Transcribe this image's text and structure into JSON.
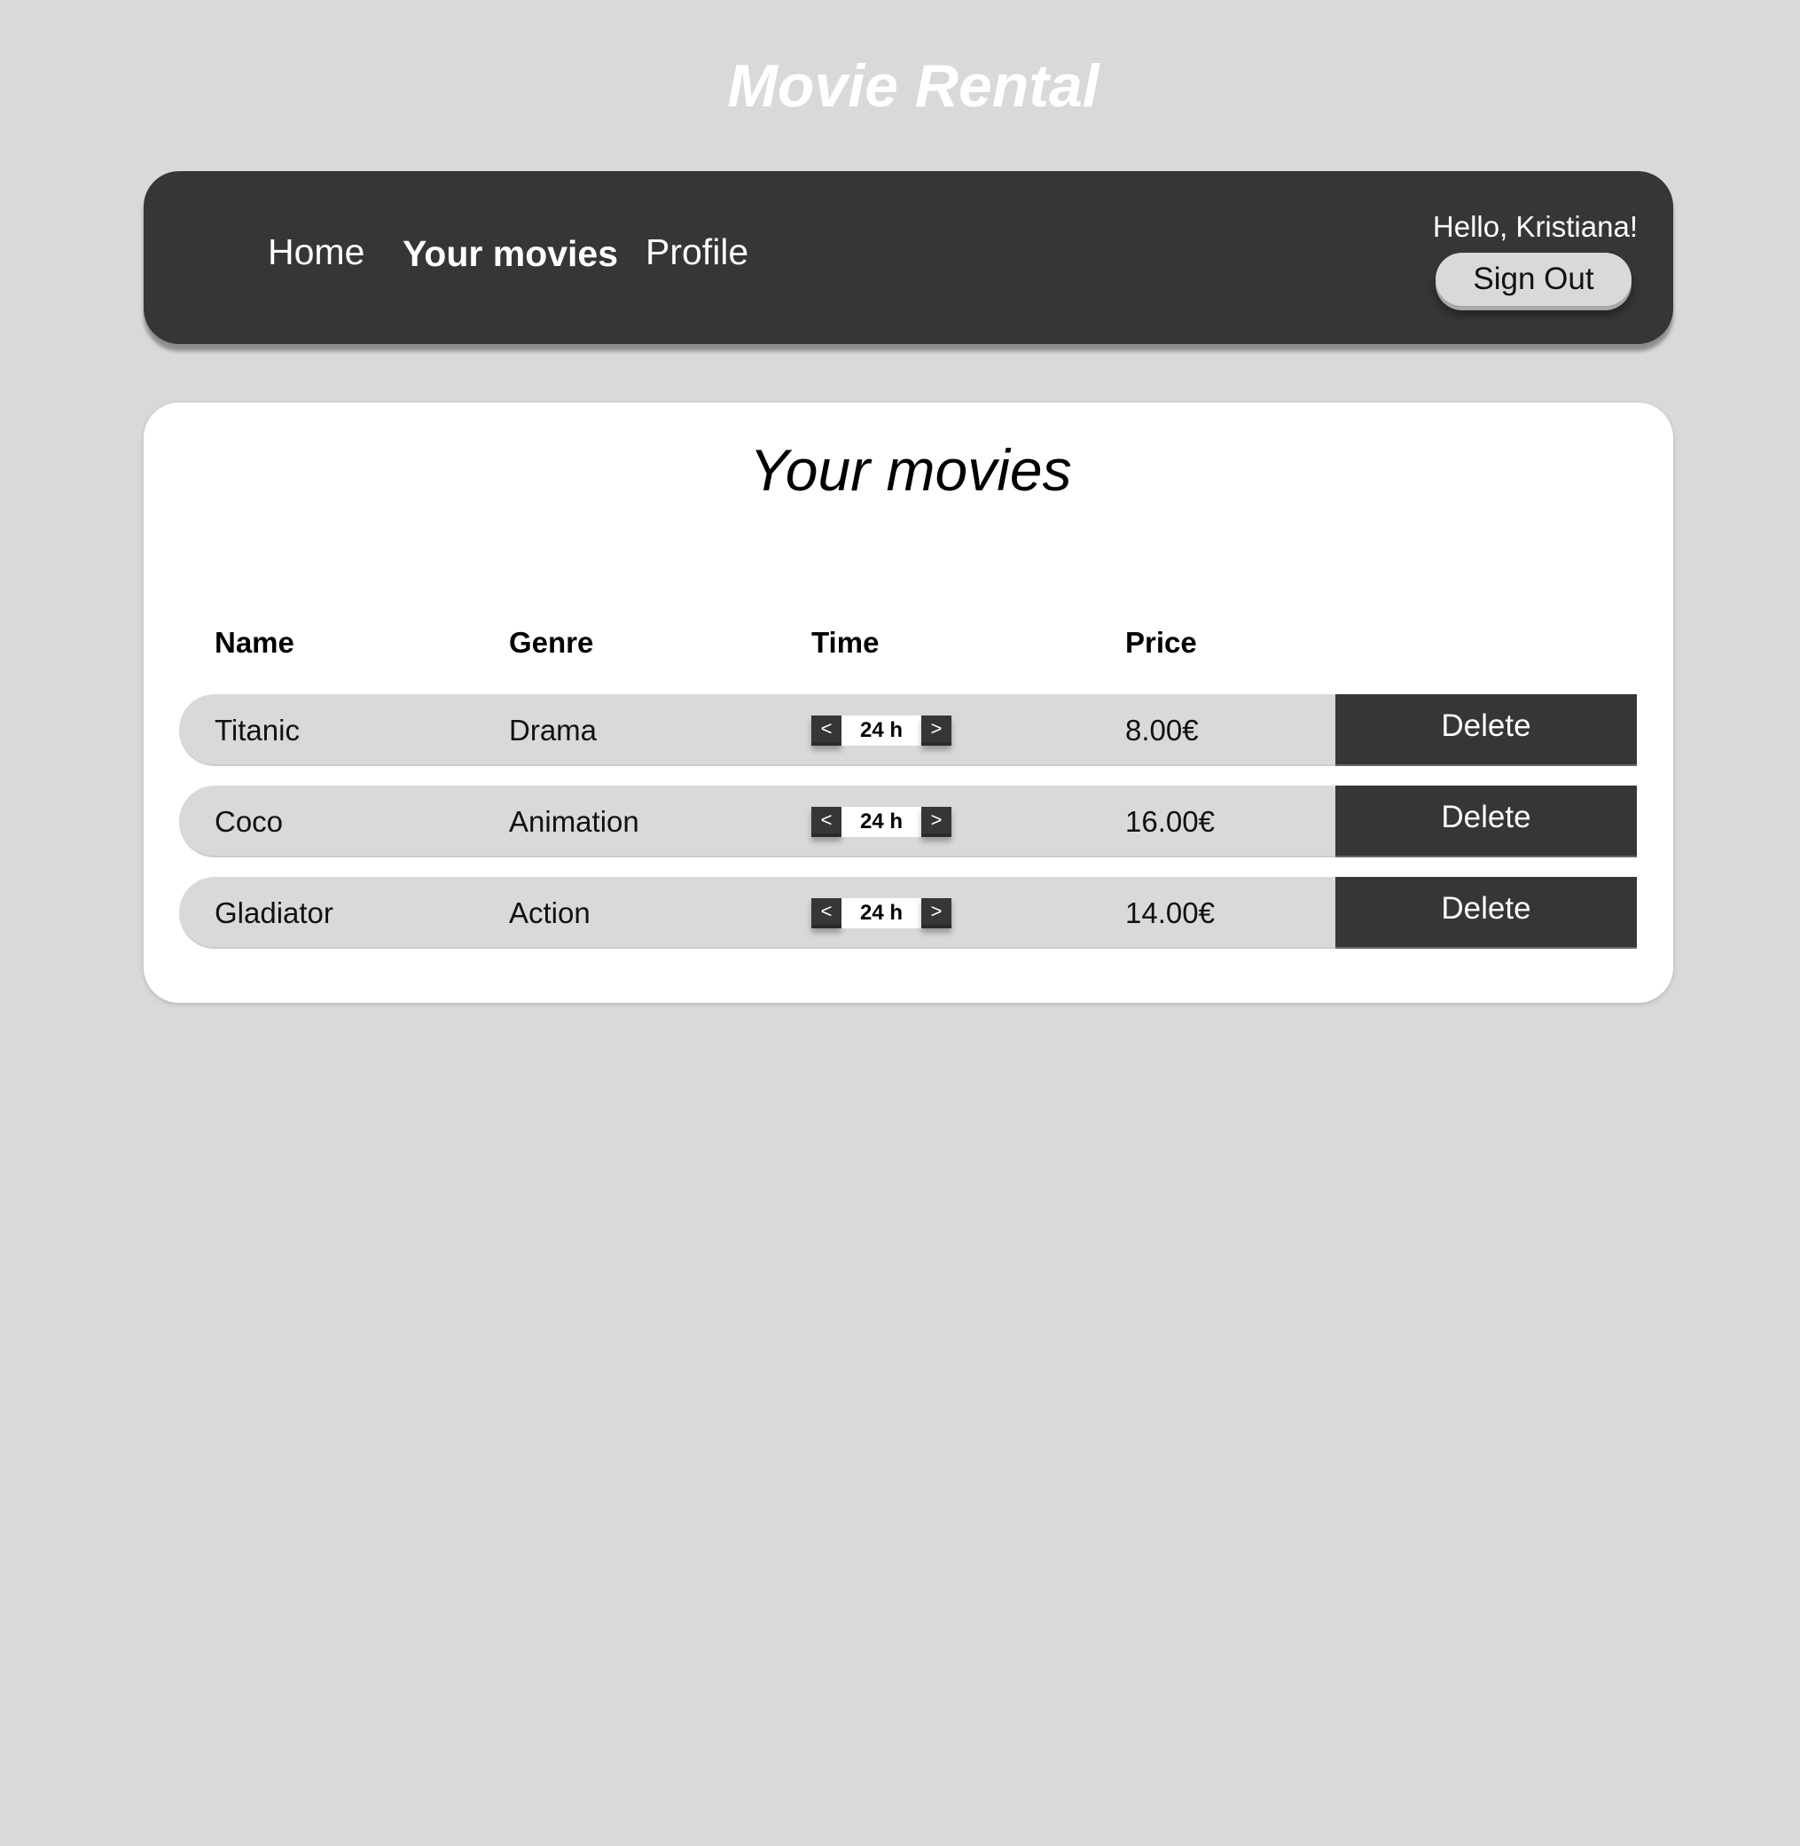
{
  "app_title": "Movie Rental",
  "nav": {
    "links": [
      "Home",
      "Your movies",
      "Profile"
    ],
    "active": "Your movies",
    "greeting": "Hello, Kristiana!",
    "sign_out": "Sign Out"
  },
  "main": {
    "title": "Your movies",
    "columns": [
      "Name",
      "Genre",
      "Time",
      "Price"
    ],
    "rows": [
      {
        "name": "Titanic",
        "genre": "Drama",
        "time": "24 h",
        "price": "8.00€",
        "action": "Delete"
      },
      {
        "name": "Coco",
        "genre": "Animation",
        "time": "24 h",
        "price": "16.00€",
        "action": "Delete"
      },
      {
        "name": "Gladiator",
        "genre": "Action",
        "time": "24 h",
        "price": "14.00€",
        "action": "Delete"
      }
    ],
    "decrement": "<",
    "increment": ">"
  }
}
